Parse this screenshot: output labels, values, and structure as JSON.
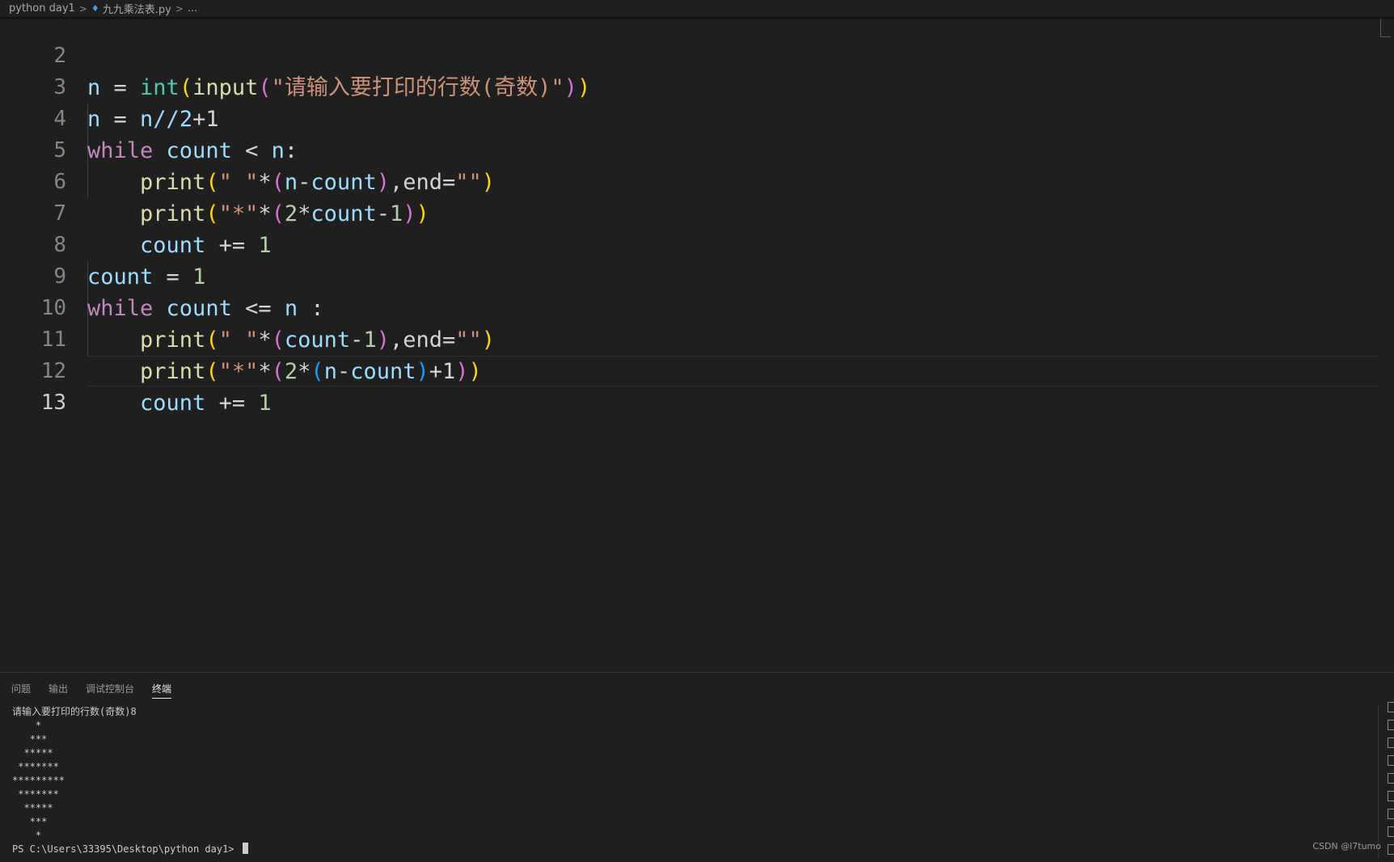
{
  "breadcrumb": {
    "folder": "python day1",
    "file": "九九乘法表.py",
    "more": "..."
  },
  "editor": {
    "active_line": "13",
    "lines": [
      {
        "n": "2"
      },
      {
        "n": "3"
      },
      {
        "n": "4"
      },
      {
        "n": "5"
      },
      {
        "n": "6"
      },
      {
        "n": "7"
      },
      {
        "n": "8"
      },
      {
        "n": "9"
      },
      {
        "n": "10"
      },
      {
        "n": "11"
      },
      {
        "n": "12"
      },
      {
        "n": "13"
      }
    ],
    "tokens": {
      "n": "n",
      "eq": " = ",
      "int": "int",
      "lp": "(",
      "rp": ")",
      "input": "input",
      "prompt": "\"请输入要打印的行数(奇数)\"",
      "n_div": "n//2",
      "plus1": "+1",
      "while": "while",
      "count": "count",
      "lt": " < ",
      "colon": ":",
      "print": "print",
      "space_str": "\" \"",
      "star": "*",
      "minus": "-",
      "comma_end": ",end=",
      "empty_str": "\"\"",
      "star_str": "\"*\"",
      "two": "2",
      "one": "1",
      "pluseq": " += ",
      "le": " <= ",
      "sp_colon": " :",
      "indent": "    "
    }
  },
  "panel": {
    "tabs": [
      "问题",
      "输出",
      "调试控制台",
      "终端"
    ],
    "active_tab": "终端",
    "terminal": [
      "请输入要打印的行数(奇数)8",
      "    *",
      "   ***",
      "  *****",
      " *******",
      "*********",
      " *******",
      "  *****",
      "   ***",
      "    *"
    ],
    "prompt": "PS C:\\Users\\33395\\Desktop\\python day1> "
  },
  "watermark": "CSDN @l7tumo",
  "icons": {
    "python_file": "python-file-icon",
    "chevron": "chevron-right-icon"
  },
  "colors": {
    "background": "#1f1f1f",
    "keyword": "#c586c0",
    "variable": "#9cdcfe",
    "function": "#dcdcaa",
    "builtin": "#4ec9b0",
    "string": "#ce9178",
    "number": "#b5cea8"
  }
}
